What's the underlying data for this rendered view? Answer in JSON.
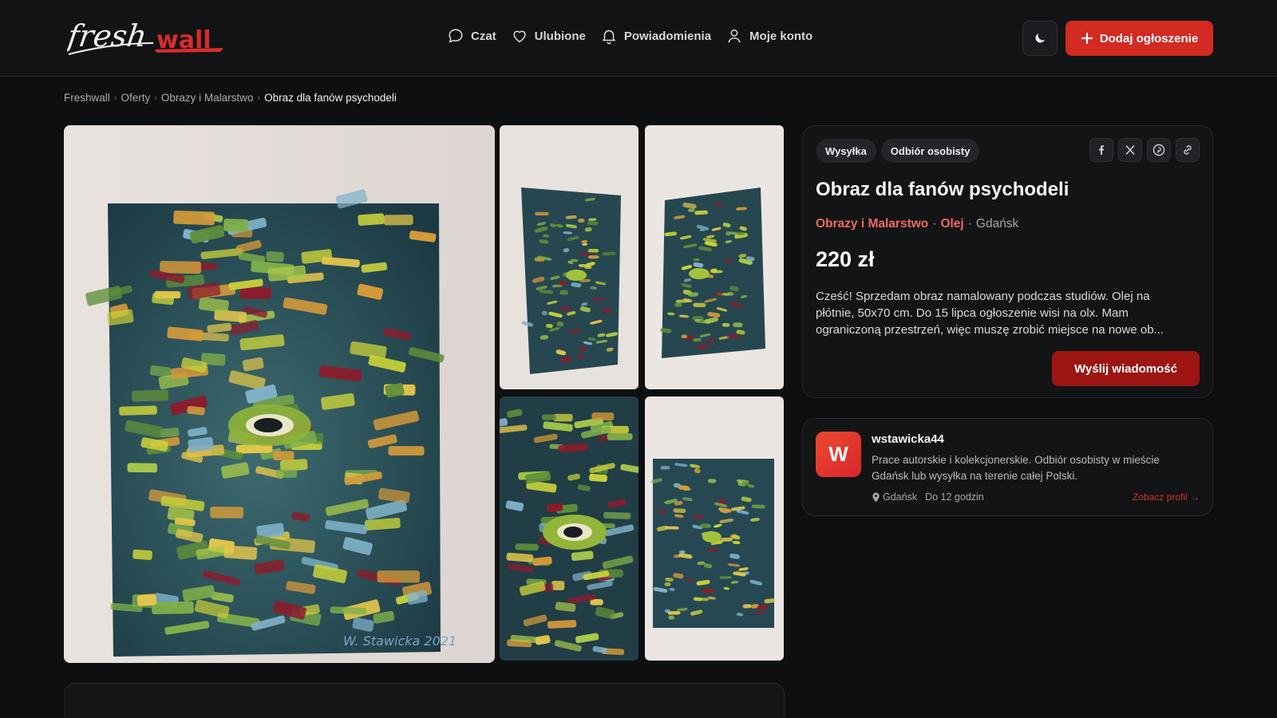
{
  "header": {
    "logo_text": "fresh wall",
    "nav": [
      {
        "label": "Czat",
        "icon": "chat-icon"
      },
      {
        "label": "Ulubione",
        "icon": "heart-icon"
      },
      {
        "label": "Powiadomienia",
        "icon": "bell-icon"
      },
      {
        "label": "Moje konto",
        "icon": "user-icon"
      }
    ],
    "theme_icon": "moon-icon",
    "add_button": "Dodaj ogłoszenie",
    "accent": "#d32a22"
  },
  "breadcrumb": [
    "Freshwall",
    "Oferty",
    "Obrazy i Malarstwo",
    "Obraz dla fanów psychodeli"
  ],
  "gallery": {
    "photos": [
      "main-photo",
      "photo-2",
      "photo-3",
      "photo-4",
      "photo-5"
    ],
    "signature": "W. Stawicka 2021"
  },
  "offer": {
    "tags": [
      "Wysyłka",
      "Odbiór osobisty"
    ],
    "share": [
      "facebook-icon",
      "x-icon",
      "pinterest-icon",
      "link-icon"
    ],
    "title": "Obraz dla fanów psychodeli",
    "category": "Obrazy i Malarstwo",
    "subcategory": "Olej",
    "city": "Gdańsk",
    "price": "220 zł",
    "description": "Cześć! Sprzedam obraz namalowany podczas studiów. Olej na płótnie, 50x70 cm. Do 15 lipca ogłoszenie wisi na olx. Mam ograniczoną przestrzeń, więc muszę zrobić miejsce na nowe ob...",
    "send_button": "Wyślij wiadomość"
  },
  "seller": {
    "initial": "W",
    "name": "wstawicka44",
    "bio": "Prace autorskie i kolekcjonerskie. Odbiór osobisty w mieście Gdańsk lub wysyłka na terenie całej Polski.",
    "city": "Gdańsk",
    "response": "Do 12 godzin",
    "profile_link": "Zobacz profil →"
  }
}
